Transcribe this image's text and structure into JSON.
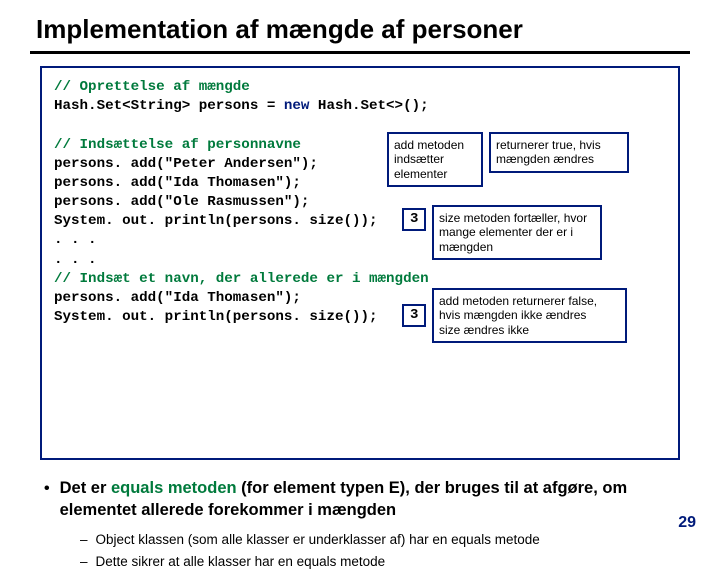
{
  "title": "Implementation af mængde af personer",
  "code": {
    "c1": "// Oprettelse af mængde",
    "l1a": "Hash.Set<String> persons = ",
    "l1kw": "new",
    "l1b": " Hash.Set<>();",
    "c2": "// Indsættelse af personnavne",
    "l2": "persons. add(\"Peter Andersen\");",
    "l3": "persons. add(\"Ida Thomasen\");",
    "l4": "persons. add(\"Ole Rasmussen\");",
    "l5": "System. out. println(persons. size());",
    "l6": ". . .",
    "l7": ". . .",
    "c3": "// Indsæt et navn, der allerede er i mængden",
    "l8": "persons. add(\"Ida Thomasen\");",
    "l9": "System. out. println(persons. size());"
  },
  "annot": {
    "a1": "add metoden indsætter elementer",
    "a2": "returnerer true, hvis mængden ændres",
    "a3": "size metoden fortæller, hvor mange elementer der er i mængden",
    "a4": "add metoden returnerer false, hvis mængden ikke ændres",
    "a5": "size ændres ikke"
  },
  "output": {
    "o1": "3",
    "o2": "3"
  },
  "bullets": {
    "main_a": "Det er ",
    "main_em": "equals metoden",
    "main_b": " (for element typen E), der bruges til at afgøre, om elementet allerede forekommer i mængden",
    "sub1": "Object klassen (som alle klasser er underklasser af) har en equals metode",
    "sub2": "Dette sikrer at alle klasser har en equals metode"
  },
  "pagenum": "29"
}
